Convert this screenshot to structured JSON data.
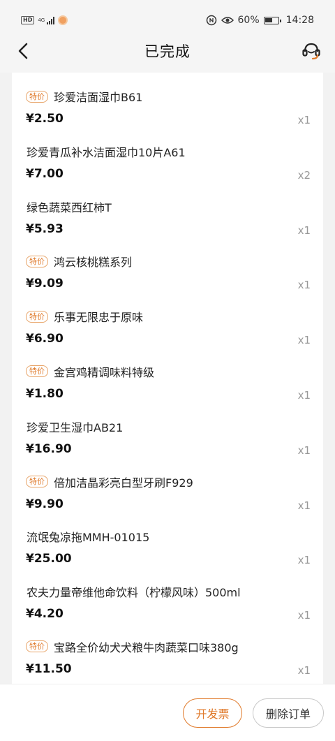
{
  "status_bar": {
    "hd": "HD",
    "network": "4G",
    "battery_percent": "60%",
    "battery_level": 0.6,
    "time": "14:28"
  },
  "nav": {
    "title": "已完成",
    "back_icon": "chevron-left-icon",
    "service_icon": "customer-service-icon"
  },
  "items": [
    {
      "name": "珍爱洁面湿巾B61",
      "tag": "特价",
      "price": "¥2.50",
      "qty": "x1"
    },
    {
      "name": "珍爱青瓜补水洁面湿巾10片A61",
      "tag": "",
      "price": "¥7.00",
      "qty": "x2"
    },
    {
      "name": "绿色蔬菜西红柿T",
      "tag": "",
      "price": "¥5.93",
      "qty": "x1"
    },
    {
      "name": "鸿云核桃糕系列",
      "tag": "特价",
      "price": "¥9.09",
      "qty": "x1"
    },
    {
      "name": "乐事无限忠于原味",
      "tag": "特价",
      "price": "¥6.90",
      "qty": "x1"
    },
    {
      "name": "金宫鸡精调味料特级",
      "tag": "特价",
      "price": "¥1.80",
      "qty": "x1"
    },
    {
      "name": "珍爱卫生湿巾AB21",
      "tag": "",
      "price": "¥16.90",
      "qty": "x1"
    },
    {
      "name": "倍加洁晶彩亮白型牙刷F929",
      "tag": "特价",
      "price": "¥9.90",
      "qty": "x1"
    },
    {
      "name": "流氓兔凉拖MMH-01015",
      "tag": "",
      "price": "¥25.00",
      "qty": "x1"
    },
    {
      "name": "农夫力量帝维他命饮料（柠檬风味）500ml",
      "tag": "",
      "price": "¥4.20",
      "qty": "x1"
    },
    {
      "name": "宝路全价幼犬犬粮牛肉蔬菜口味380g",
      "tag": "特价",
      "price": "¥11.50",
      "qty": "x1"
    }
  ],
  "actions": {
    "invoice_label": "开发票",
    "delete_label": "删除订单"
  },
  "colors": {
    "accent": "#e07a2b",
    "background": "#f2f2f2",
    "card": "#ffffff"
  }
}
